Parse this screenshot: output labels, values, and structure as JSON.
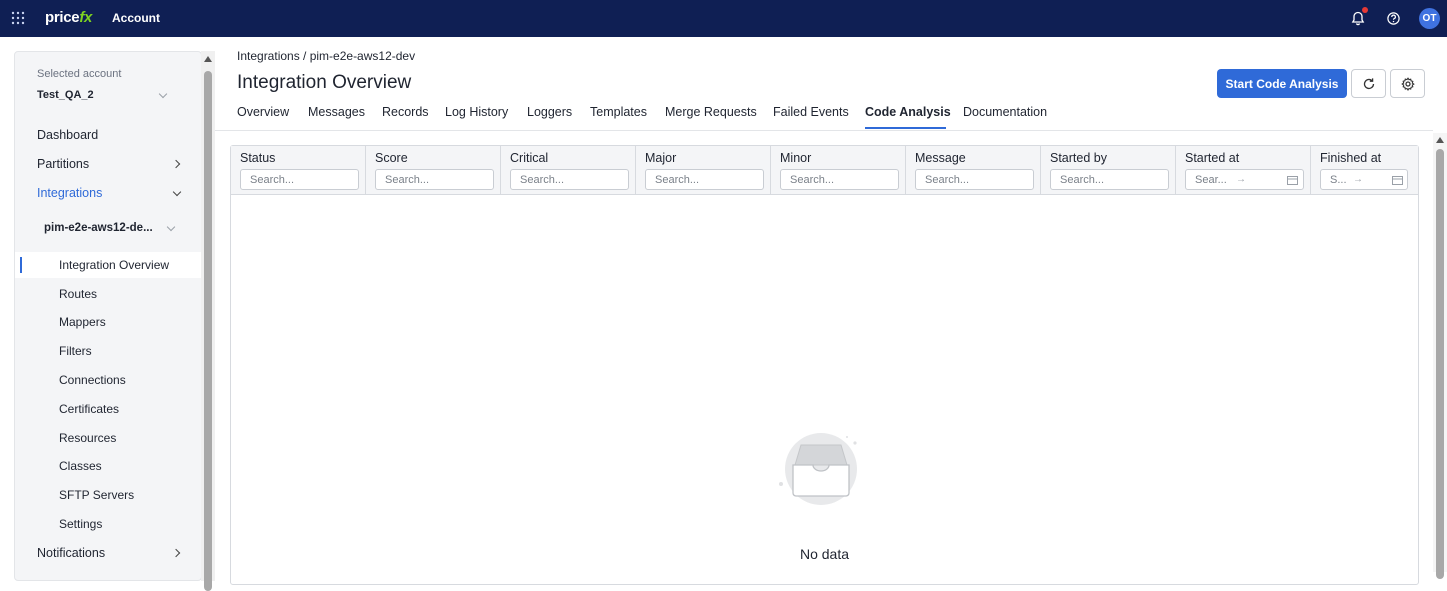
{
  "topbar": {
    "logo_text": "price",
    "logo_suffix": "fx",
    "app_title": "Account",
    "avatar_initials": "OT",
    "icons": [
      "apps-grid-icon",
      "bell-icon",
      "help-icon"
    ]
  },
  "sidebar": {
    "account_label": "Selected account",
    "account_value": "Test_QA_2",
    "items": [
      {
        "label": "Dashboard"
      },
      {
        "label": "Partitions"
      },
      {
        "label": "Integrations"
      },
      {
        "label": "Notifications"
      }
    ],
    "sub_item": "pim-e2e-aws12-de...",
    "leaves": [
      {
        "label": "Integration Overview"
      },
      {
        "label": "Routes"
      },
      {
        "label": "Mappers"
      },
      {
        "label": "Filters"
      },
      {
        "label": "Connections"
      },
      {
        "label": "Certificates"
      },
      {
        "label": "Resources"
      },
      {
        "label": "Classes"
      },
      {
        "label": "SFTP Servers"
      },
      {
        "label": "Settings"
      }
    ]
  },
  "header": {
    "breadcrumb": "Integrations / pim-e2e-aws12-dev",
    "title": "Integration Overview",
    "primary_button": "Start Code Analysis"
  },
  "tabs": [
    {
      "label": "Overview"
    },
    {
      "label": "Messages"
    },
    {
      "label": "Records"
    },
    {
      "label": "Log History"
    },
    {
      "label": "Loggers"
    },
    {
      "label": "Templates"
    },
    {
      "label": "Merge Requests"
    },
    {
      "label": "Failed Events"
    },
    {
      "label": "Code Analysis"
    },
    {
      "label": "Documentation"
    }
  ],
  "active_tab": "Code Analysis",
  "table": {
    "columns": [
      {
        "label": "Status",
        "placeholder": "Search..."
      },
      {
        "label": "Score",
        "placeholder": "Search..."
      },
      {
        "label": "Critical",
        "placeholder": "Search..."
      },
      {
        "label": "Major",
        "placeholder": "Search..."
      },
      {
        "label": "Minor",
        "placeholder": "Search..."
      },
      {
        "label": "Message",
        "placeholder": "Search..."
      },
      {
        "label": "Started by",
        "placeholder": "Search..."
      },
      {
        "label": "Started at",
        "placeholder": "Sear..."
      },
      {
        "label": "Finished at",
        "placeholder": "S..."
      }
    ],
    "empty_text": "No data"
  },
  "colors": {
    "topbar_bg": "#0f1f54",
    "accent": "#2f6ad8",
    "logo_accent": "#7ed321",
    "notification_dot": "#e53935"
  }
}
